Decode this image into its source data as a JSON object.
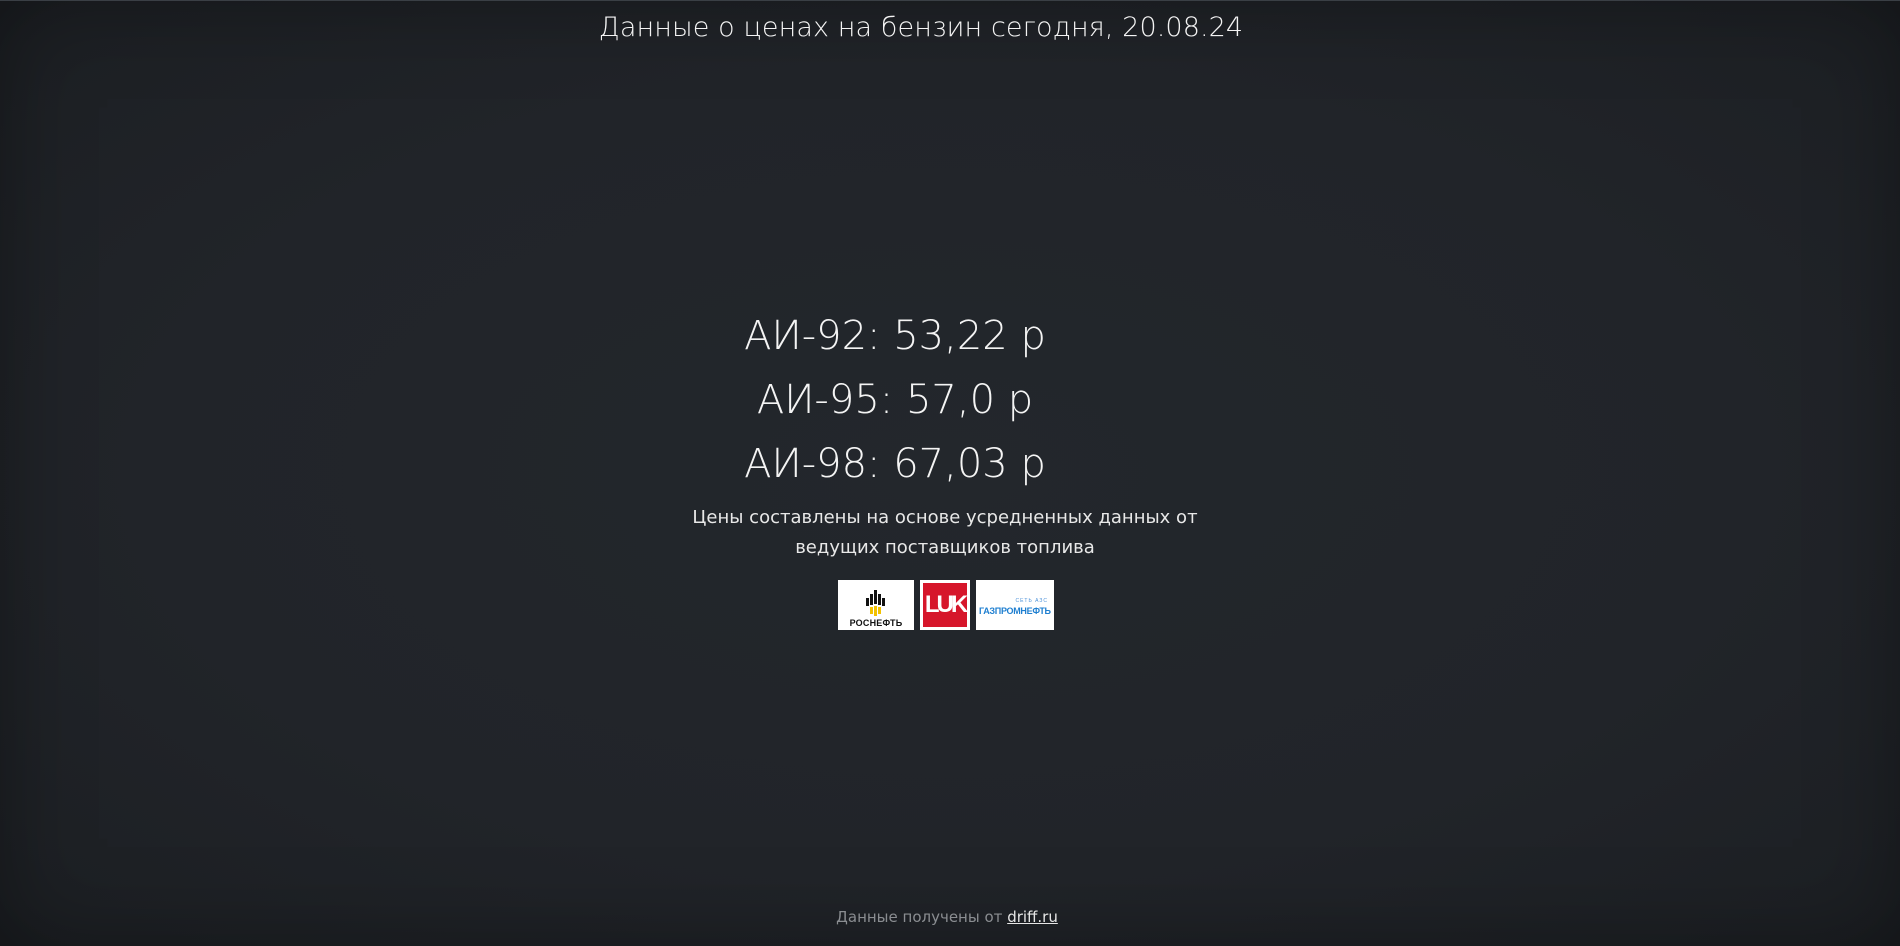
{
  "page": {
    "title": "Данные о ценах на бензин сегодня, 20.08.24"
  },
  "prices": [
    {
      "label": "АИ-92: 53,22 р"
    },
    {
      "label": "АИ-95: 57,0 р"
    },
    {
      "label": "АИ-98: 67,03 р"
    }
  ],
  "note": "Цены составлены на основе усредненных данных от ведущих поставщиков топлива",
  "logos": {
    "rosneft": {
      "name": "РОСНЕФТЬ",
      "icon": "rosneft-logo"
    },
    "lukoil": {
      "name": "LUK",
      "icon": "lukoil-logo",
      "color": "#d6162b"
    },
    "gazprom": {
      "name": "ГАЗПРОМНЕФТЬ",
      "tagline": "СЕТЬ АЗС",
      "icon": "gazpromneft-logo",
      "color": "#1f7fd0"
    }
  },
  "footer": {
    "prefix": "Данные получены от",
    "link_text": "driff.ru"
  },
  "colors": {
    "background": "#212429",
    "text": "#f4f4f4",
    "muted": "#8a8d91"
  }
}
